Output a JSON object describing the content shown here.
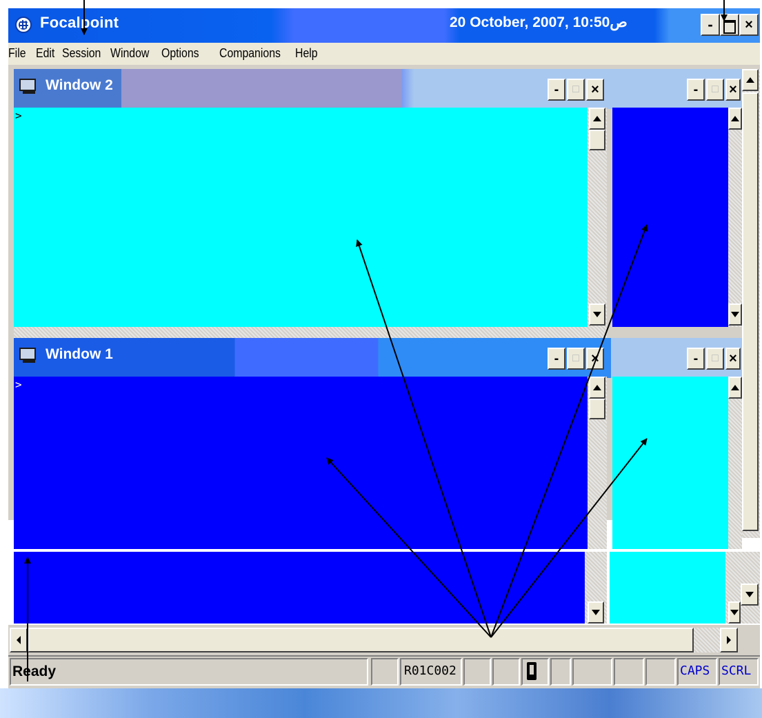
{
  "titlebar": {
    "app_title": "Focalpoint",
    "clock": "20 October, 2007, ص10:50"
  },
  "menu": {
    "items": [
      "File",
      "Edit",
      "Session",
      "Window",
      "Options",
      "Companions",
      "Help"
    ]
  },
  "windows": [
    {
      "title": "Window 2",
      "prompt": ">"
    },
    {
      "title": "Window 1",
      "prompt": ">"
    }
  ],
  "status": {
    "text": "Ready",
    "position": "R01C002",
    "caps": "CAPS",
    "scrl": "SCRL"
  },
  "colors": {
    "cyan_pane": "#00ffff",
    "blue_pane": "#0000ff",
    "title_blue": "#0a58e6"
  },
  "icons": [
    "globe-icon",
    "terminal-window-icon",
    "minimize-icon",
    "maximize-icon",
    "close-icon",
    "arrow-icon"
  ]
}
